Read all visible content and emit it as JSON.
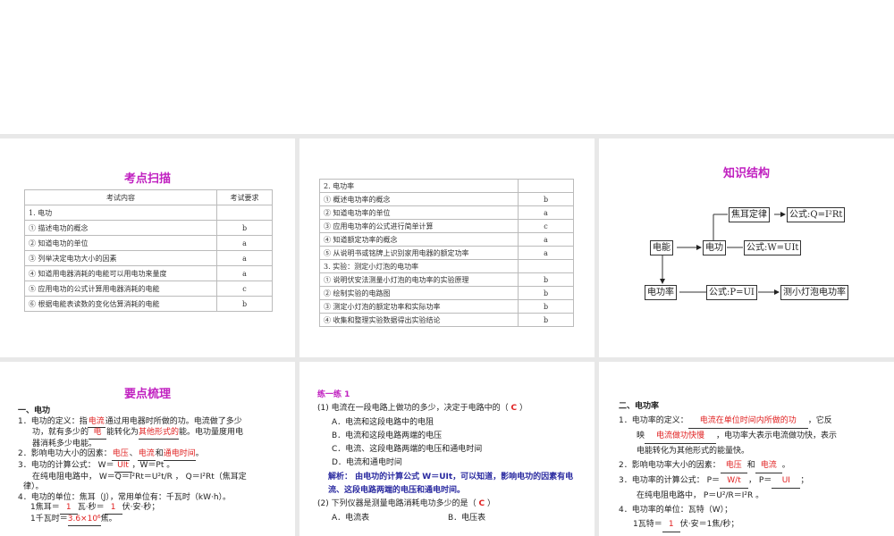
{
  "slide1": {
    "title": "考点扫描",
    "headers": [
      "考试内容",
      "考试要求"
    ],
    "rows": [
      [
        "1. 电功",
        ""
      ],
      [
        "① 描述电功的概念",
        "b"
      ],
      [
        "② 知道电功的单位",
        "a"
      ],
      [
        "③ 列举决定电功大小的因素",
        "a"
      ],
      [
        "④ 知道用电器消耗的电能可以用电功来量度",
        "a"
      ],
      [
        "⑤ 应用电功的公式计算用电器消耗的电能",
        "c"
      ],
      [
        "⑥ 根据电能表读数的变化估算消耗的电能",
        "b"
      ]
    ]
  },
  "slide2": {
    "rows": [
      [
        "2. 电功率",
        ""
      ],
      [
        "① 概述电功率的概念",
        "b"
      ],
      [
        "② 知道电功率的单位",
        "a"
      ],
      [
        "③ 应用电功率的公式进行简单计算",
        "c"
      ],
      [
        "④ 知道额定功率的概念",
        "a"
      ],
      [
        "⑤ 从说明书或铭牌上识别家用电器的额定功率",
        "a"
      ],
      [
        "3. 实验：测定小灯泡的电功率",
        ""
      ],
      [
        "① 说明伏安法测量小灯泡的电功率的实验原理",
        "b"
      ],
      [
        "② 绘制实验的电路图",
        "b"
      ],
      [
        "③ 测定小灯泡的额定功率和实际功率",
        "b"
      ],
      [
        "④ 收集和整理实验数据得出实验结论",
        "b"
      ]
    ]
  },
  "slide3": {
    "title": "知识结构",
    "nodes": {
      "dianneng": "电能",
      "diangong": "电功",
      "jiaoer": "焦耳定律",
      "formula_q": "公式:Q=I²Rt",
      "formula_w": "公式:W=UIt",
      "gonglv": "电功率",
      "formula_p": "公式:P=UI",
      "measure": "测小灯泡电功率"
    }
  },
  "slide4": {
    "title": "要点梳理",
    "section": "一、电功",
    "l1a": "1．电功的定义：指",
    "f1": "电流",
    "l1b": "通过用电器时所做的功。电流做了多少",
    "l2a": "功，就有多少的",
    "f2": "电",
    "l2b": "能转化为",
    "f3": "其他形式的",
    "l2c": "能。电功量度用电",
    "l3": "器消耗多少电能。",
    "l4a": "2．影响电功大小的因素：",
    "f4": "电压",
    "l4b": "、",
    "f5": "电流",
    "l4c": "和",
    "f6": "通电时间",
    "l4d": "。",
    "l5a": "3．电功的计算公式： W＝",
    "f7": "UIt",
    "l5b": "，W＝Pt 。",
    "l6": "在纯电阻电路中， W＝Q＝I²Rt＝U²t/R ， Q＝I²Rt（焦耳定",
    "l7": "律）。",
    "l8": "4．电功的单位：焦耳（J），常用单位有：千瓦时（kW·h）。",
    "l9a": "1焦耳＝",
    "f8": "1",
    "l9b": "瓦·秒＝",
    "f9": "1",
    "l9c": "伏·安·秒；",
    "l10a": "1千瓦时＝",
    "f10": "3.6×10⁶",
    "l10b": "焦。"
  },
  "slide5": {
    "heading": "练一练 1",
    "q1": "(1) 电流在一段电路上做功的多少，决定于电路中的（",
    "a1": "C",
    "close": "）",
    "opts": [
      "A．电流和这段电路中的电阻",
      "B．电流和这段电路两端的电压",
      "C．电流、这段电路两端的电压和通电时间",
      "D．电流和通电时间"
    ],
    "analysis_label": "解析：",
    "analysis": "由电功的计算公式 W＝UIt，可以知道，影响电功的因素有电流、这段电路两端的电压和通电时间。",
    "q2": "(2) 下列仪器是测量电路消耗电功多少的是（",
    "a2": "C",
    "q2opts": [
      "A．电流表",
      "B．电压表"
    ]
  },
  "slide6": {
    "section": "二、电功率",
    "l1a": "1．电功率的定义：",
    "f1": "电流在单位时间内所做的功",
    "l1b": "，它反",
    "l2a": "映",
    "f2": "电流做功快慢",
    "l2b": "，电功率大表示电流做功快，表示",
    "l3": "电能转化为其他形式的能量快。",
    "l4a": "2．影响电功率大小的因素：",
    "f3": "电压",
    "l4b": "和",
    "f4": "电流",
    "l4c": "。",
    "l5a": "3．电功率的计算公式： P＝",
    "f5": "W/t",
    "l5b": "， P＝",
    "f6": "UI",
    "l5c": "；",
    "l6": "在纯电阻电路中， P＝U²/R＝I²R 。",
    "l7": "4．电功率的单位：瓦特（W）；",
    "l8a": "1瓦特＝",
    "f7": "1",
    "l8b": "伏·安＝1焦/秒；"
  }
}
